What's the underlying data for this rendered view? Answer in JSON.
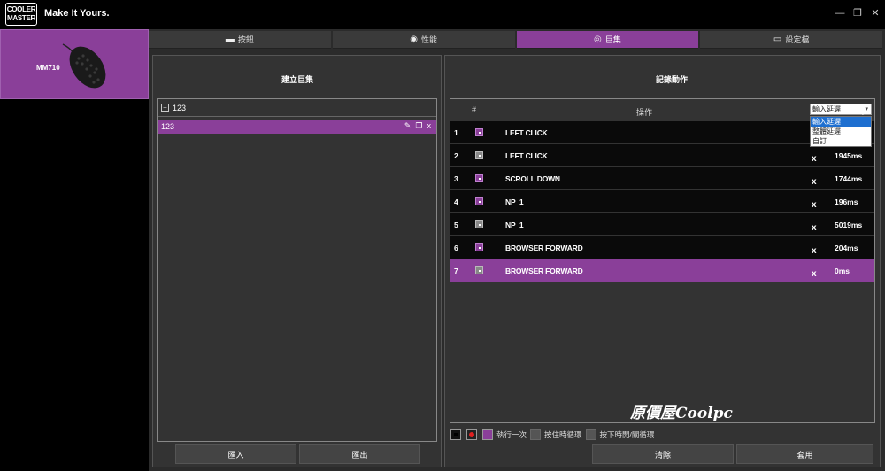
{
  "app": {
    "logo_line1": "COOLER",
    "logo_line2": "MASTER",
    "tagline": "Make It Yours."
  },
  "window_controls": {
    "minimize": "—",
    "maximize": "❐",
    "close": "✕"
  },
  "device": {
    "name": "MM710"
  },
  "tabs": [
    {
      "label": "按鈕",
      "icon": "keyboard-icon"
    },
    {
      "label": "性能",
      "icon": "speed-icon"
    },
    {
      "label": "巨集",
      "icon": "macro-icon"
    },
    {
      "label": "設定檔",
      "icon": "folder-icon"
    }
  ],
  "left_panel": {
    "title": "建立巨集",
    "list_header": "123",
    "add_symbol": "+",
    "items": [
      {
        "label": "123",
        "edit": "✎",
        "copy": "❐",
        "delete": "x"
      }
    ],
    "import_label": "匯入",
    "export_label": "匯出"
  },
  "right_panel": {
    "title": "記錄動作",
    "columns": {
      "num": "#",
      "action": "操作"
    },
    "rows": [
      {
        "num": "1",
        "color": "purple",
        "action": "LEFT CLICK",
        "x": "",
        "delay": ""
      },
      {
        "num": "2",
        "color": "gray",
        "action": "LEFT CLICK",
        "x": "x",
        "delay": "1945ms"
      },
      {
        "num": "3",
        "color": "purple",
        "action": "SCROLL DOWN",
        "x": "x",
        "delay": "1744ms"
      },
      {
        "num": "4",
        "color": "purple",
        "action": "NP_1",
        "x": "x",
        "delay": "196ms"
      },
      {
        "num": "5",
        "color": "gray",
        "action": "NP_1",
        "x": "x",
        "delay": "5019ms"
      },
      {
        "num": "6",
        "color": "purple",
        "action": "BROWSER FORWARD",
        "x": "x",
        "delay": "204ms"
      },
      {
        "num": "7",
        "color": "gray",
        "action": "BROWSER FORWARD",
        "x": "x",
        "delay": "0ms"
      }
    ],
    "selected_row": "7",
    "delay_dropdown": {
      "value": "輸入延遲",
      "arrow": "▾",
      "options": [
        "輸入延遲",
        "整體延遲",
        "自訂"
      ],
      "highlighted": "輸入延遲"
    },
    "watermark": "原價屋Coolpc",
    "controls": {
      "once_label": "執行一次",
      "hold_loop_label": "按住時循環",
      "toggle_loop_label": "按下時開/關循環"
    },
    "clear_label": "清除",
    "apply_label": "套用"
  },
  "colors": {
    "accent": "#8a3f99",
    "background": "#2b2b2b",
    "row": "#0a0a0a"
  }
}
